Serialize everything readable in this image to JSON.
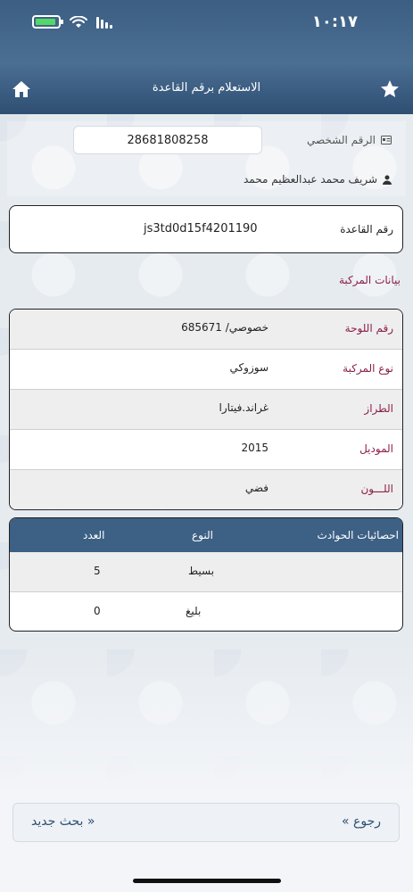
{
  "status_bar": {
    "time": "١٠:١٧"
  },
  "header": {
    "title": "الاستعلام برقم القاعدة"
  },
  "user": {
    "id_label": "الرقم الشخصي",
    "id_value": "28681808258",
    "name": "شريف محمد عبدالعظيم محمد"
  },
  "base": {
    "label": "رقم القاعدة",
    "value": "js3td0d15f4201190"
  },
  "vehicle": {
    "section_title": "بيانات المركبة",
    "rows": [
      {
        "label": "رقم اللوحة",
        "value": "خصوصي/ 685671"
      },
      {
        "label": "نوع المركبة",
        "value": "سوزوكي"
      },
      {
        "label": "الطراز",
        "value": "غراند.فيتارا"
      },
      {
        "label": "الموديل",
        "value": "2015"
      },
      {
        "label": "اللـــون",
        "value": "فضي"
      }
    ]
  },
  "accidents": {
    "headers": {
      "title": "احصائيات الحوادث",
      "type": "النوع",
      "count": "العدد"
    },
    "rows": [
      {
        "type": "بسيط",
        "count": "5"
      },
      {
        "type": "بليغ",
        "count": "0"
      }
    ]
  },
  "footer": {
    "back_label": "« رجوع",
    "new_search_label": "بحث جديد »"
  }
}
